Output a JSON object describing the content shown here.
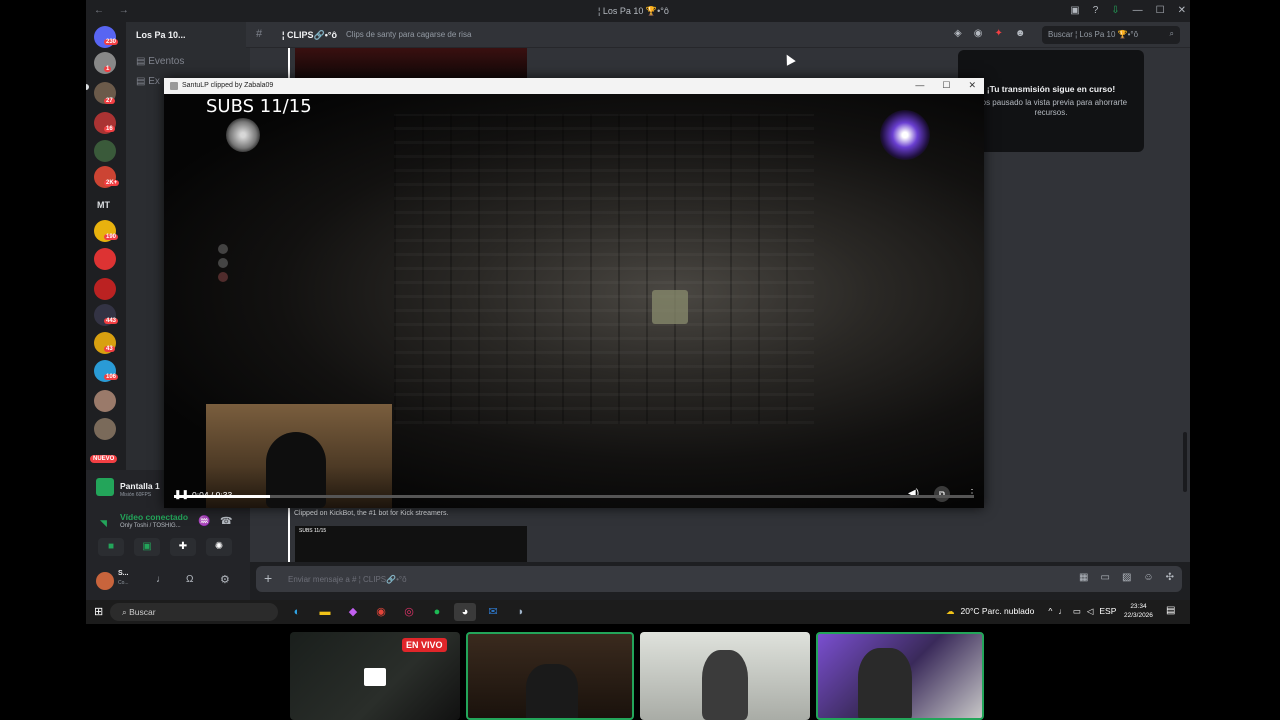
{
  "titlebar": {
    "nav": "← →",
    "title": "¦ Los Pa 10 🏆•°ô",
    "icons": [
      "▣",
      "?",
      "⇩",
      "—",
      "☐",
      "✕"
    ]
  },
  "server": {
    "name": "Los Pa 10...",
    "badges": [
      "230",
      "1",
      "27",
      "16",
      "2K+",
      "190",
      "443",
      "43",
      "106"
    ],
    "mt_label": "MT",
    "nuevo": "NUEVO"
  },
  "channels": {
    "items": [
      {
        "label": "Eventos",
        "icon": "▤"
      },
      {
        "label": "Ex",
        "icon": "▤"
      }
    ]
  },
  "channel_header": {
    "name": "¦ CLIPS🔗•°ô",
    "topic": "Clips de santy para cagarse de risa",
    "search_placeholder": "Buscar ¦ Los Pa 10 🏆•°ô"
  },
  "stream_note": {
    "heading": "¡Tu transmisión sigue en curso!",
    "body": "mos pausado la vista previa para ahorrarte recursos."
  },
  "chat": {
    "message": "Clipped on KickBot, the #1 bot for Kick streamers.",
    "thumb_label": "SUBS 11/15"
  },
  "user_panel": {
    "screen_share": "Pantalla 1",
    "screen_sub": "Misión 60FPS",
    "voice_status": "Vídeo conectado",
    "voice_channel": "Only Toshi / TOSHIG...",
    "user_name": "S...",
    "user_status": "Co..."
  },
  "composer": {
    "placeholder": "Enviar mensaje a # ¦ CLIPS🔗•°ô"
  },
  "player": {
    "window_title": "SantuLP clipped by Zabala09",
    "overlay_text": "SUBS 11/15",
    "time": "0:04 / 0:33",
    "progress": 0.12
  },
  "taskbar": {
    "search": "Buscar",
    "weather": "20°C  Parc. nublado",
    "lang": "ESP",
    "time": "23:34",
    "date": "22/3/2026"
  },
  "cameras": {
    "live_badge": "EN VIVO"
  }
}
